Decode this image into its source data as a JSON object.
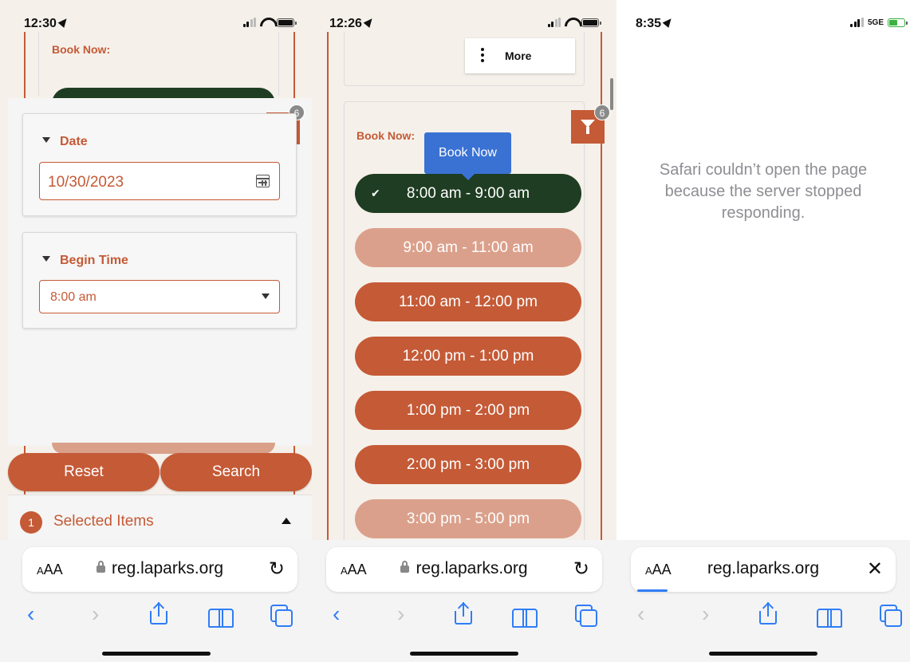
{
  "screens": [
    {
      "status": {
        "time": "12:30"
      },
      "page": {
        "book_now_label": "Book Now:",
        "filter_badge": "6",
        "date": {
          "heading": "Date",
          "value": "10/30/2023"
        },
        "begin_time": {
          "heading": "Begin Time",
          "value": "8:00 am"
        },
        "reset_label": "Reset",
        "search_label": "Search",
        "selected": {
          "count": "1",
          "label": "Selected Items"
        }
      },
      "safari": {
        "aa": "AA",
        "url": "reg.laparks.org"
      }
    },
    {
      "status": {
        "time": "12:26"
      },
      "page": {
        "more_label": "More",
        "book_now_label": "Book Now:",
        "filter_badge": "6",
        "tooltip": "Book Now",
        "slots": [
          {
            "label": "8:00 am - 9:00 am",
            "state": "selected"
          },
          {
            "label": "9:00 am - 11:00 am",
            "state": "unavailable"
          },
          {
            "label": "11:00 am - 12:00 pm",
            "state": "available"
          },
          {
            "label": "12:00 pm - 1:00 pm",
            "state": "available"
          },
          {
            "label": "1:00 pm - 2:00 pm",
            "state": "available"
          },
          {
            "label": "2:00 pm - 3:00 pm",
            "state": "available"
          },
          {
            "label": "3:00 pm - 5:00 pm",
            "state": "unavailable"
          }
        ]
      },
      "safari": {
        "aa": "AA",
        "url": "reg.laparks.org"
      }
    },
    {
      "status": {
        "time": "8:35",
        "network": "5GE"
      },
      "error_message": "Safari couldn’t open the page because the server stopped responding.",
      "safari": {
        "aa": "AA",
        "url": "reg.laparks.org"
      }
    }
  ],
  "colors": {
    "brand": "#c55a36",
    "selected_slot": "#1e3d22",
    "unavailable_slot": "#dba08b",
    "tooltip": "#3a72d4",
    "safari_blue": "#2f7df6"
  },
  "icons": [
    "location-arrow-icon",
    "signal-icon",
    "wifi-icon",
    "battery-icon",
    "close-icon",
    "filter-icon",
    "calendar-icon",
    "dropdown-arrow-icon",
    "caret-up-icon",
    "kebab-menu-icon",
    "checkmark-icon",
    "lock-icon",
    "reload-icon",
    "back-icon",
    "forward-icon",
    "share-icon",
    "bookmarks-icon",
    "tabs-icon"
  ]
}
